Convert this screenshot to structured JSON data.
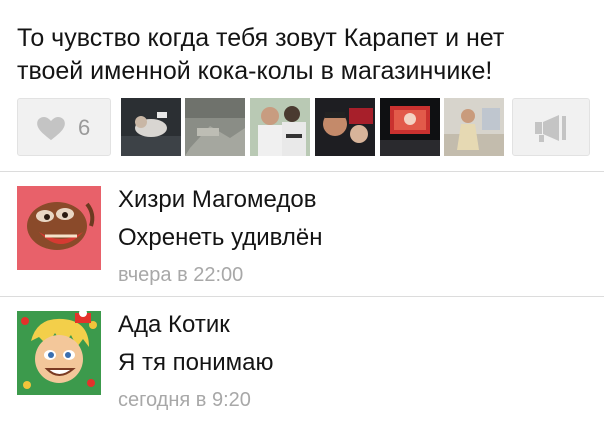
{
  "post": {
    "text_line1": "То чувство когда тебя зовут Карапет и нет",
    "text_line2": "твоей именной кока-колы в магазинчике!"
  },
  "actions": {
    "like_icon": "heart-icon",
    "like_count": "6",
    "share_icon": "megaphone-icon"
  },
  "likers": [
    {
      "avatar": "liker-avatar-1"
    },
    {
      "avatar": "liker-avatar-2"
    },
    {
      "avatar": "liker-avatar-3"
    },
    {
      "avatar": "liker-avatar-4"
    },
    {
      "avatar": "liker-avatar-5"
    },
    {
      "avatar": "liker-avatar-6"
    }
  ],
  "comments": [
    {
      "author": "Хизри Магомедов",
      "text": "Охренеть удивлён",
      "time": "вчера в 22:00"
    },
    {
      "author": "Ада Котик",
      "text": "Я тя понимаю",
      "time": "сегодня в 9:20"
    }
  ],
  "colors": {
    "button_bg": "#f1f1f1",
    "icon_gray": "#c4c4c4",
    "meta_gray": "#a8a8a8",
    "text": "#141414",
    "divider": "#dcdcdc"
  }
}
